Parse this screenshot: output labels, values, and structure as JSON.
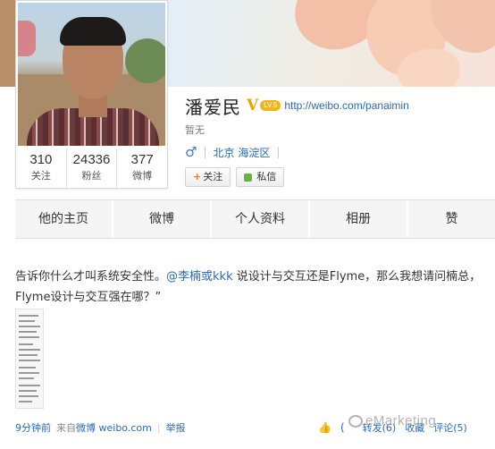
{
  "profile": {
    "name": "潘爱民",
    "verified_badge": "V",
    "level_badge": "LV.5",
    "homepage": "http://weibo.com/panaimin",
    "bio": "暂无",
    "gender_icon": "male-icon",
    "location": "北京 海淀区",
    "stats": [
      {
        "value": "310",
        "label": "关注"
      },
      {
        "value": "24336",
        "label": "粉丝"
      },
      {
        "value": "377",
        "label": "微博"
      }
    ],
    "follow_button": "关注",
    "message_button": "私信"
  },
  "tabs": [
    "他的主页",
    "微博",
    "个人资料",
    "相册",
    "赞"
  ],
  "post": {
    "text_before": "告诉你什么才叫系统安全性。",
    "mention": "@李楠或kkk",
    "text_after": " 说设计与交互还是Flyme，那么我想请问楠总，Flyme设计与交互强在哪？”",
    "time": "9分钟前",
    "source_prefix": "来自",
    "source": "微博 weibo.com",
    "report": "举报",
    "like": "(",
    "repost": "转发(6)",
    "favorite": "收藏",
    "comment": "评论(5)"
  },
  "watermark": "eMarketing",
  "colors": {
    "link": "#2a6ab6",
    "verified": "#e6a400",
    "follow_plus": "#ff7a1a",
    "message_dot": "#67b43b"
  }
}
